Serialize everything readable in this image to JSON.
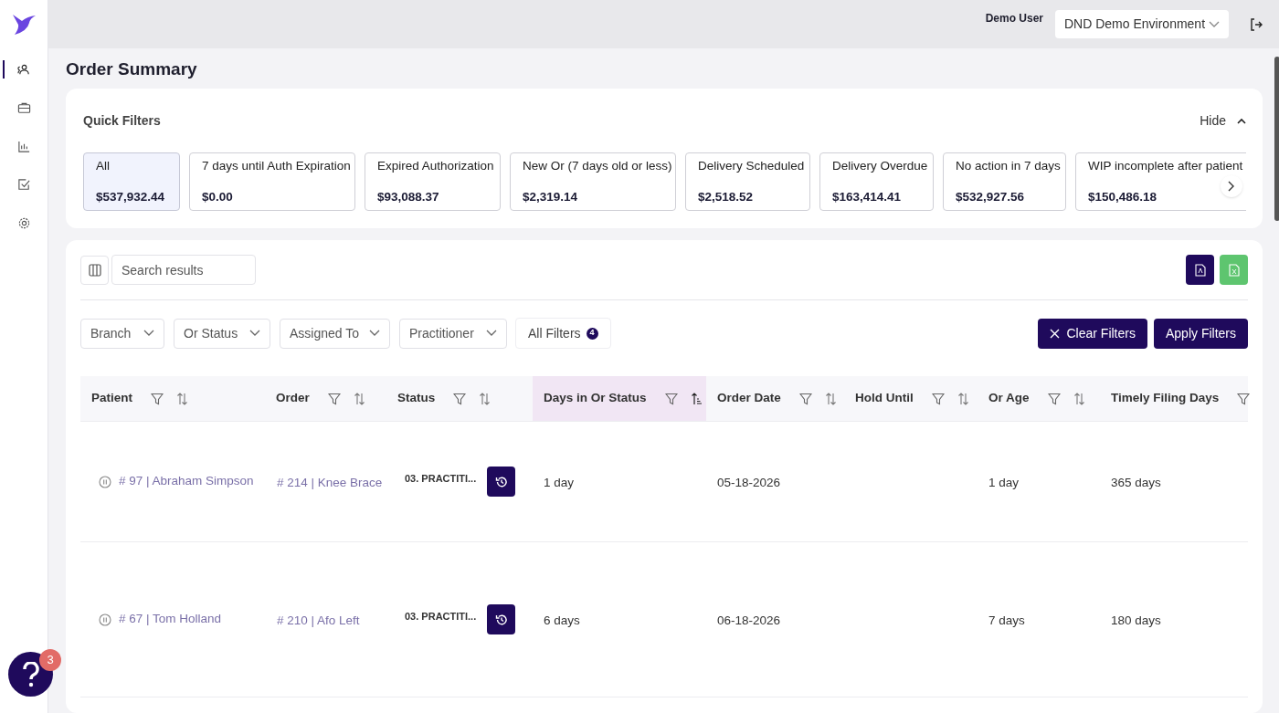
{
  "header": {
    "user": "Demo User",
    "environment": "DND Demo Environment"
  },
  "sidebar": {
    "items": [
      {
        "selected": true
      },
      {
        "selected": false
      },
      {
        "selected": false
      },
      {
        "selected": false
      },
      {
        "selected": false
      }
    ]
  },
  "page_title": "Order Summary",
  "quick_filters": {
    "title": "Quick Filters",
    "toggle": "Hide",
    "cards": [
      {
        "label": "All",
        "amount": "$537,932.44",
        "selected": true
      },
      {
        "label": "7 days until Auth Expiration",
        "amount": "$0.00",
        "selected": false
      },
      {
        "label": "Expired Authorization",
        "amount": "$93,088.37",
        "selected": false
      },
      {
        "label": "New Or (7 days old or less)",
        "amount": "$2,319.14",
        "selected": false
      },
      {
        "label": "Delivery Scheduled",
        "amount": "$2,518.52",
        "selected": false
      },
      {
        "label": "Delivery Overdue",
        "amount": "$163,414.41",
        "selected": false
      },
      {
        "label": "No action in 7 days",
        "amount": "$532,927.56",
        "selected": false
      },
      {
        "label": "WIP incomplete after patient",
        "amount": "$150,486.18",
        "selected": false
      }
    ]
  },
  "search": {
    "placeholder": "Search results"
  },
  "filters": {
    "dropdowns": [
      "Branch",
      "Or Status",
      "Assigned To",
      "Practitioner"
    ],
    "all_filters": {
      "label": "All Filters",
      "count": "4"
    },
    "clear": "Clear Filters",
    "apply": "Apply Filters"
  },
  "table": {
    "columns": [
      {
        "label": "Patient",
        "kind": "sortable",
        "selected": false
      },
      {
        "label": "Order",
        "kind": "sortable",
        "selected": false
      },
      {
        "label": "Status",
        "kind": "sortable",
        "selected": false
      },
      {
        "label": "Days in Or Status",
        "kind": "sorted",
        "selected": true
      },
      {
        "label": "Order Date",
        "kind": "sortable",
        "selected": false
      },
      {
        "label": "Hold Until",
        "kind": "sortable",
        "selected": false
      },
      {
        "label": "Or Age",
        "kind": "sortable",
        "selected": false
      },
      {
        "label": "Timely Filing Days",
        "kind": "filter",
        "selected": false
      }
    ],
    "rows": [
      {
        "patient": "# 97 | Abraham Simpson",
        "order": "# 214 | Knee Brace",
        "status": "03. PRACTITI...",
        "days_in_status": "1 day",
        "order_date": "05-18-2026",
        "or_age": "1 day",
        "timely_filing_days": "365 days"
      },
      {
        "patient": "# 67 | Tom Holland",
        "order": "# 210 | Afo Left",
        "status": "03. PRACTITI...",
        "days_in_status": "6 days",
        "order_date": "06-18-2026",
        "or_age": "7 days",
        "timely_filing_days": "180 days"
      }
    ]
  },
  "help": {
    "badge": "3"
  }
}
